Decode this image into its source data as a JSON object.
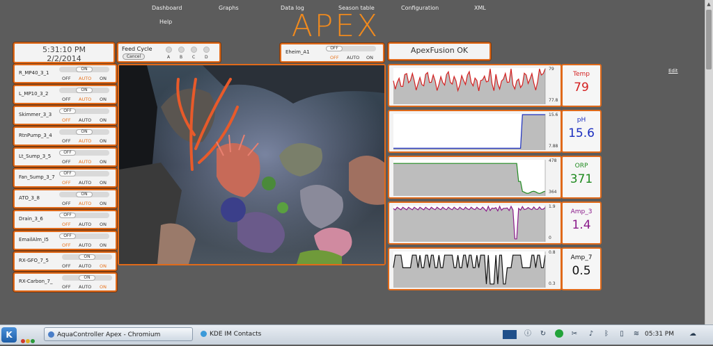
{
  "nav": {
    "items": [
      "Dashboard",
      "Graphs",
      "Data log",
      "Season table",
      "Configuration",
      "XML"
    ],
    "help": "Help"
  },
  "logo": {
    "text": "APEX"
  },
  "clock": {
    "time": "5:31:10 PM",
    "date": "2/2/2014"
  },
  "feed": {
    "title": "Feed Cycle",
    "cancel": "Cancel",
    "options": [
      "A",
      "B",
      "C",
      "D"
    ]
  },
  "eheim": {
    "name": "Eheim_A1",
    "knob": "OFF",
    "states": [
      "OFF",
      "AUTO",
      "ON"
    ],
    "active": "OFF"
  },
  "fusion": {
    "status": "ApexFusion OK"
  },
  "edit": "Edit",
  "outlets": [
    {
      "name": "R_MP40_3_1",
      "knob": "ON",
      "active": "AUTO"
    },
    {
      "name": "L_MP10_3_2",
      "knob": "ON",
      "active": "AUTO"
    },
    {
      "name": "Skimmer_3_3",
      "knob": "OFF",
      "active": "OFF"
    },
    {
      "name": "RtnPump_3_4",
      "knob": "ON",
      "active": "AUTO"
    },
    {
      "name": "Lt_Sump_3_5",
      "knob": "OFF",
      "active": "AUTO"
    },
    {
      "name": "Fan_Sump_3_7",
      "knob": "OFF",
      "active": "OFF"
    },
    {
      "name": "ATO_3_8",
      "knob": "ON",
      "active": "AUTO"
    },
    {
      "name": "Drain_3_6",
      "knob": "OFF",
      "active": "OFF"
    },
    {
      "name": "EmailAlm_I5",
      "knob": "OFF",
      "active": "OFF"
    },
    {
      "name": "RX-GFO_7_5",
      "knob": "ON",
      "active": "ON"
    },
    {
      "name": "RX-Carbon_7_",
      "knob": "ON",
      "active": "ON"
    }
  ],
  "state_labels": [
    "OFF",
    "AUTO",
    "ON"
  ],
  "probes": [
    {
      "name": "Temp",
      "value": "79",
      "color": "#d42020",
      "ymax": "79",
      "ymin": "77.8",
      "shape": "temp"
    },
    {
      "name": "pH",
      "value": "15.6",
      "color": "#1a2dbf",
      "ymax": "15.6",
      "ymin": "7.88",
      "shape": "ph"
    },
    {
      "name": "ORP",
      "value": "371",
      "color": "#1f8a1f",
      "ymax": "478",
      "ymin": "364",
      "shape": "orp"
    },
    {
      "name": "Amp_3",
      "value": "1.4",
      "color": "#8a1a8a",
      "ymax": "1.9",
      "ymin": "0",
      "shape": "amp3"
    },
    {
      "name": "Amp_7",
      "value": "0.5",
      "color": "#111111",
      "ymax": "0.8",
      "ymin": "0.3",
      "shape": "amp7"
    }
  ],
  "taskbar": {
    "tasks": [
      "AquaController Apex - Chromium",
      "KDE IM Contacts"
    ],
    "time": "05:31 PM"
  },
  "colors": {
    "accent": "#e06a1a",
    "background": "#5c5c5c"
  }
}
